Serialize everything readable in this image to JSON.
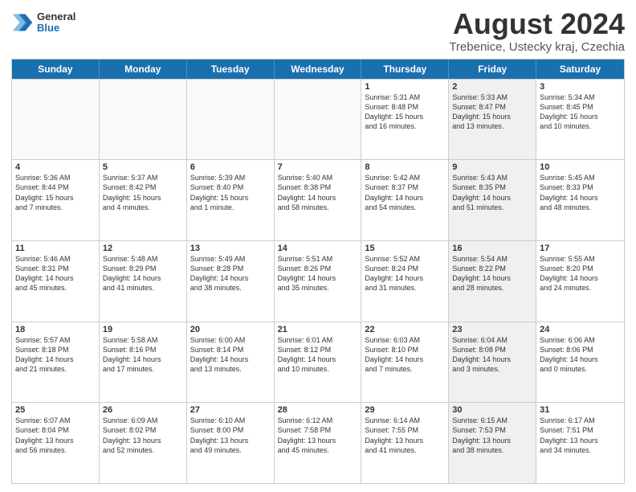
{
  "header": {
    "logo_general": "General",
    "logo_blue": "Blue",
    "title": "August 2024",
    "location": "Trebenice, Ustecky kraj, Czechia"
  },
  "weekdays": [
    "Sunday",
    "Monday",
    "Tuesday",
    "Wednesday",
    "Thursday",
    "Friday",
    "Saturday"
  ],
  "rows": [
    [
      {
        "day": "",
        "info": "",
        "empty": true
      },
      {
        "day": "",
        "info": "",
        "empty": true
      },
      {
        "day": "",
        "info": "",
        "empty": true
      },
      {
        "day": "",
        "info": "",
        "empty": true
      },
      {
        "day": "1",
        "info": "Sunrise: 5:31 AM\nSunset: 8:48 PM\nDaylight: 15 hours\nand 16 minutes.",
        "empty": false
      },
      {
        "day": "2",
        "info": "Sunrise: 5:33 AM\nSunset: 8:47 PM\nDaylight: 15 hours\nand 13 minutes.",
        "empty": false,
        "shaded": true
      },
      {
        "day": "3",
        "info": "Sunrise: 5:34 AM\nSunset: 8:45 PM\nDaylight: 15 hours\nand 10 minutes.",
        "empty": false
      }
    ],
    [
      {
        "day": "4",
        "info": "Sunrise: 5:36 AM\nSunset: 8:44 PM\nDaylight: 15 hours\nand 7 minutes.",
        "empty": false
      },
      {
        "day": "5",
        "info": "Sunrise: 5:37 AM\nSunset: 8:42 PM\nDaylight: 15 hours\nand 4 minutes.",
        "empty": false
      },
      {
        "day": "6",
        "info": "Sunrise: 5:39 AM\nSunset: 8:40 PM\nDaylight: 15 hours\nand 1 minute.",
        "empty": false
      },
      {
        "day": "7",
        "info": "Sunrise: 5:40 AM\nSunset: 8:38 PM\nDaylight: 14 hours\nand 58 minutes.",
        "empty": false
      },
      {
        "day": "8",
        "info": "Sunrise: 5:42 AM\nSunset: 8:37 PM\nDaylight: 14 hours\nand 54 minutes.",
        "empty": false
      },
      {
        "day": "9",
        "info": "Sunrise: 5:43 AM\nSunset: 8:35 PM\nDaylight: 14 hours\nand 51 minutes.",
        "empty": false,
        "shaded": true
      },
      {
        "day": "10",
        "info": "Sunrise: 5:45 AM\nSunset: 8:33 PM\nDaylight: 14 hours\nand 48 minutes.",
        "empty": false
      }
    ],
    [
      {
        "day": "11",
        "info": "Sunrise: 5:46 AM\nSunset: 8:31 PM\nDaylight: 14 hours\nand 45 minutes.",
        "empty": false
      },
      {
        "day": "12",
        "info": "Sunrise: 5:48 AM\nSunset: 8:29 PM\nDaylight: 14 hours\nand 41 minutes.",
        "empty": false
      },
      {
        "day": "13",
        "info": "Sunrise: 5:49 AM\nSunset: 8:28 PM\nDaylight: 14 hours\nand 38 minutes.",
        "empty": false
      },
      {
        "day": "14",
        "info": "Sunrise: 5:51 AM\nSunset: 8:26 PM\nDaylight: 14 hours\nand 35 minutes.",
        "empty": false
      },
      {
        "day": "15",
        "info": "Sunrise: 5:52 AM\nSunset: 8:24 PM\nDaylight: 14 hours\nand 31 minutes.",
        "empty": false
      },
      {
        "day": "16",
        "info": "Sunrise: 5:54 AM\nSunset: 8:22 PM\nDaylight: 14 hours\nand 28 minutes.",
        "empty": false,
        "shaded": true
      },
      {
        "day": "17",
        "info": "Sunrise: 5:55 AM\nSunset: 8:20 PM\nDaylight: 14 hours\nand 24 minutes.",
        "empty": false
      }
    ],
    [
      {
        "day": "18",
        "info": "Sunrise: 5:57 AM\nSunset: 8:18 PM\nDaylight: 14 hours\nand 21 minutes.",
        "empty": false
      },
      {
        "day": "19",
        "info": "Sunrise: 5:58 AM\nSunset: 8:16 PM\nDaylight: 14 hours\nand 17 minutes.",
        "empty": false
      },
      {
        "day": "20",
        "info": "Sunrise: 6:00 AM\nSunset: 8:14 PM\nDaylight: 14 hours\nand 13 minutes.",
        "empty": false
      },
      {
        "day": "21",
        "info": "Sunrise: 6:01 AM\nSunset: 8:12 PM\nDaylight: 14 hours\nand 10 minutes.",
        "empty": false
      },
      {
        "day": "22",
        "info": "Sunrise: 6:03 AM\nSunset: 8:10 PM\nDaylight: 14 hours\nand 7 minutes.",
        "empty": false
      },
      {
        "day": "23",
        "info": "Sunrise: 6:04 AM\nSunset: 8:08 PM\nDaylight: 14 hours\nand 3 minutes.",
        "empty": false,
        "shaded": true
      },
      {
        "day": "24",
        "info": "Sunrise: 6:06 AM\nSunset: 8:06 PM\nDaylight: 14 hours\nand 0 minutes.",
        "empty": false
      }
    ],
    [
      {
        "day": "25",
        "info": "Sunrise: 6:07 AM\nSunset: 8:04 PM\nDaylight: 13 hours\nand 56 minutes.",
        "empty": false
      },
      {
        "day": "26",
        "info": "Sunrise: 6:09 AM\nSunset: 8:02 PM\nDaylight: 13 hours\nand 52 minutes.",
        "empty": false
      },
      {
        "day": "27",
        "info": "Sunrise: 6:10 AM\nSunset: 8:00 PM\nDaylight: 13 hours\nand 49 minutes.",
        "empty": false
      },
      {
        "day": "28",
        "info": "Sunrise: 6:12 AM\nSunset: 7:58 PM\nDaylight: 13 hours\nand 45 minutes.",
        "empty": false
      },
      {
        "day": "29",
        "info": "Sunrise: 6:14 AM\nSunset: 7:55 PM\nDaylight: 13 hours\nand 41 minutes.",
        "empty": false
      },
      {
        "day": "30",
        "info": "Sunrise: 6:15 AM\nSunset: 7:53 PM\nDaylight: 13 hours\nand 38 minutes.",
        "empty": false,
        "shaded": true
      },
      {
        "day": "31",
        "info": "Sunrise: 6:17 AM\nSunset: 7:51 PM\nDaylight: 13 hours\nand 34 minutes.",
        "empty": false
      }
    ]
  ]
}
